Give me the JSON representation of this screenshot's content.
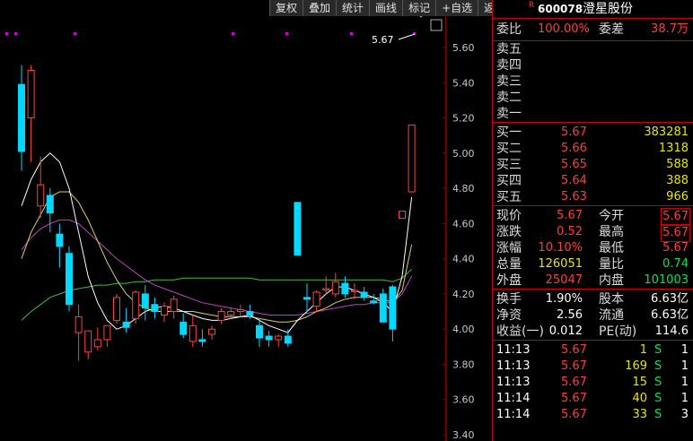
{
  "toolbar": [
    "复权",
    "叠加",
    "统计",
    "画线",
    "标记",
    "+自选",
    "返回"
  ],
  "stock": {
    "badge": "R",
    "code": "600078",
    "name": "澄星股份"
  },
  "weibi": {
    "label": "委比",
    "value": "100.00%",
    "label2": "委差",
    "value2": "38.7万"
  },
  "sell": [
    {
      "label": "卖五"
    },
    {
      "label": "卖四"
    },
    {
      "label": "卖三"
    },
    {
      "label": "卖二"
    },
    {
      "label": "卖一"
    }
  ],
  "buy": [
    {
      "label": "买一",
      "price": "5.67",
      "vol": "383281"
    },
    {
      "label": "买二",
      "price": "5.66",
      "vol": "1318"
    },
    {
      "label": "买三",
      "price": "5.65",
      "vol": "588"
    },
    {
      "label": "买四",
      "price": "5.64",
      "vol": "388"
    },
    {
      "label": "买五",
      "price": "5.63",
      "vol": "966"
    }
  ],
  "quote": [
    {
      "l1": "现价",
      "v1": "5.67",
      "l2": "今开",
      "v2": "5.67"
    },
    {
      "l1": "涨跌",
      "v1": "0.52",
      "l2": "最高",
      "v2": "5.67"
    },
    {
      "l1": "涨幅",
      "v1": "10.10%",
      "l2": "最低",
      "v2": "5.67"
    },
    {
      "l1": "总量",
      "v1": "126051",
      "l2": "量比",
      "v2": "0.74"
    },
    {
      "l1": "外盘",
      "v1": "25047",
      "l2": "内盘",
      "v2": "101003"
    }
  ],
  "stats": [
    {
      "l1": "换手",
      "v1": "1.90%",
      "l2": "股本",
      "v2": "6.63亿"
    },
    {
      "l1": "净资",
      "v1": "2.56",
      "l2": "流通",
      "v2": "6.63亿"
    },
    {
      "l1": "收益(一)",
      "v1": "0.012",
      "l2": "PE(动)",
      "v2": "114.6"
    }
  ],
  "trades": [
    {
      "time": "11:13",
      "price": "5.67",
      "vol": "1",
      "side": "S",
      "n": "1"
    },
    {
      "time": "11:13",
      "price": "5.67",
      "vol": "169",
      "side": "S",
      "n": "1"
    },
    {
      "time": "11:13",
      "price": "5.67",
      "vol": "15",
      "side": "S",
      "n": "1"
    },
    {
      "time": "11:14",
      "price": "5.67",
      "vol": "40",
      "side": "S",
      "n": "1"
    },
    {
      "time": "11:14",
      "price": "5.67",
      "vol": "33",
      "side": "S",
      "n": "3"
    }
  ],
  "chart_data": {
    "type": "candlestick",
    "y_ticks": [
      "5.60",
      "5.40",
      "5.20",
      "5.00",
      "4.80",
      "4.60",
      "4.40",
      "4.20",
      "4.00",
      "3.80",
      "3.60",
      "3.40"
    ],
    "ylim": [
      3.4,
      5.65
    ],
    "last_price_label": "5.67",
    "candles": [
      [
        5.39,
        5.5,
        4.9,
        5.01
      ],
      [
        5.2,
        5.5,
        4.95,
        5.47
      ],
      [
        4.7,
        4.98,
        4.63,
        4.82
      ],
      [
        4.76,
        4.8,
        4.55,
        4.66
      ],
      [
        4.54,
        4.6,
        4.35,
        4.47
      ],
      [
        4.43,
        4.47,
        4.1,
        4.14
      ],
      [
        3.98,
        4.14,
        3.82,
        4.07
      ],
      [
        3.87,
        3.99,
        3.83,
        3.99
      ],
      [
        3.9,
        4.01,
        3.88,
        3.94
      ],
      [
        3.94,
        4.02,
        3.9,
        4.02
      ],
      [
        4.05,
        4.2,
        4.03,
        4.18
      ],
      [
        4.04,
        4.12,
        3.98,
        4.01
      ],
      [
        4.06,
        4.22,
        4.03,
        4.21
      ],
      [
        4.2,
        4.25,
        4.05,
        4.12
      ],
      [
        4.14,
        4.18,
        4.06,
        4.1
      ],
      [
        4.08,
        4.15,
        4.04,
        4.13
      ],
      [
        4.1,
        4.19,
        4.06,
        4.17
      ],
      [
        4.04,
        4.09,
        3.95,
        3.97
      ],
      [
        3.93,
        4.08,
        3.9,
        4.02
      ],
      [
        3.94,
        4.0,
        3.9,
        3.93
      ],
      [
        3.97,
        4.02,
        3.94,
        4.0
      ],
      [
        4.05,
        4.12,
        4.03,
        4.1
      ],
      [
        4.08,
        4.12,
        4.06,
        4.1
      ],
      [
        4.1,
        4.14,
        4.07,
        4.11
      ],
      [
        4.1,
        4.14,
        4.06,
        4.08
      ],
      [
        4.02,
        4.06,
        3.9,
        3.95
      ],
      [
        3.96,
        3.99,
        3.9,
        3.94
      ],
      [
        3.94,
        3.97,
        3.9,
        3.96
      ],
      [
        3.96,
        4.0,
        3.9,
        3.92
      ],
      [
        4.72,
        4.72,
        4.42,
        4.42
      ],
      [
        4.18,
        4.26,
        4.1,
        4.17
      ],
      [
        4.13,
        4.22,
        4.1,
        4.21
      ],
      [
        4.23,
        4.3,
        4.2,
        4.23
      ],
      [
        4.2,
        4.32,
        4.18,
        4.27
      ],
      [
        4.26,
        4.3,
        4.18,
        4.2
      ],
      [
        4.22,
        4.26,
        4.17,
        4.22
      ],
      [
        4.21,
        4.24,
        4.16,
        4.18
      ],
      [
        4.16,
        4.2,
        4.14,
        4.15
      ],
      [
        4.2,
        4.23,
        4.04,
        4.04
      ],
      [
        4.24,
        4.25,
        3.93,
        4.0
      ],
      [
        4.63,
        4.63,
        4.63,
        4.67
      ],
      [
        4.78,
        5.16,
        4.78,
        5.16
      ]
    ],
    "ma_white": [
      4.7,
      4.85,
      4.95,
      5.0,
      4.95,
      4.8,
      4.55,
      4.3,
      4.15,
      4.05,
      4.0,
      4.02,
      4.06,
      4.1,
      4.12,
      4.13,
      4.12,
      4.1,
      4.08,
      4.06,
      4.05,
      4.05,
      4.06,
      4.07,
      4.08,
      4.05,
      4.02,
      4.0,
      3.98,
      4.05,
      4.1,
      4.15,
      4.2,
      4.24,
      4.24,
      4.22,
      4.2,
      4.18,
      4.15,
      4.1,
      4.3,
      4.75
    ],
    "ma_yellow": [
      4.4,
      4.55,
      4.65,
      4.75,
      4.78,
      4.78,
      4.72,
      4.62,
      4.5,
      4.38,
      4.28,
      4.2,
      4.15,
      4.12,
      4.1,
      4.1,
      4.1,
      4.1,
      4.1,
      4.09,
      4.08,
      4.07,
      4.07,
      4.07,
      4.07,
      4.06,
      4.05,
      4.04,
      4.04,
      4.05,
      4.07,
      4.1,
      4.12,
      4.15,
      4.17,
      4.18,
      4.18,
      4.18,
      4.17,
      4.15,
      4.22,
      4.48
    ],
    "ma_purple": [
      4.45,
      4.52,
      4.57,
      4.6,
      4.62,
      4.62,
      4.6,
      4.55,
      4.5,
      4.45,
      4.4,
      4.36,
      4.32,
      4.28,
      4.25,
      4.23,
      4.21,
      4.19,
      4.17,
      4.15,
      4.14,
      4.13,
      4.12,
      4.11,
      4.1,
      4.09,
      4.08,
      4.08,
      4.08,
      4.08,
      4.09,
      4.1,
      4.11,
      4.12,
      4.13,
      4.14,
      4.14,
      4.15,
      4.15,
      4.15,
      4.2,
      4.3
    ],
    "ma_green": [
      4.05,
      4.1,
      4.14,
      4.18,
      4.2,
      4.22,
      4.23,
      4.24,
      4.25,
      4.25,
      4.26,
      4.26,
      4.27,
      4.27,
      4.28,
      4.28,
      4.28,
      4.29,
      4.29,
      4.29,
      4.29,
      4.29,
      4.29,
      4.29,
      4.29,
      4.28,
      4.28,
      4.28,
      4.28,
      4.28,
      4.28,
      4.28,
      4.28,
      4.28,
      4.28,
      4.28,
      4.28,
      4.28,
      4.28,
      4.27,
      4.29,
      4.34
    ]
  }
}
